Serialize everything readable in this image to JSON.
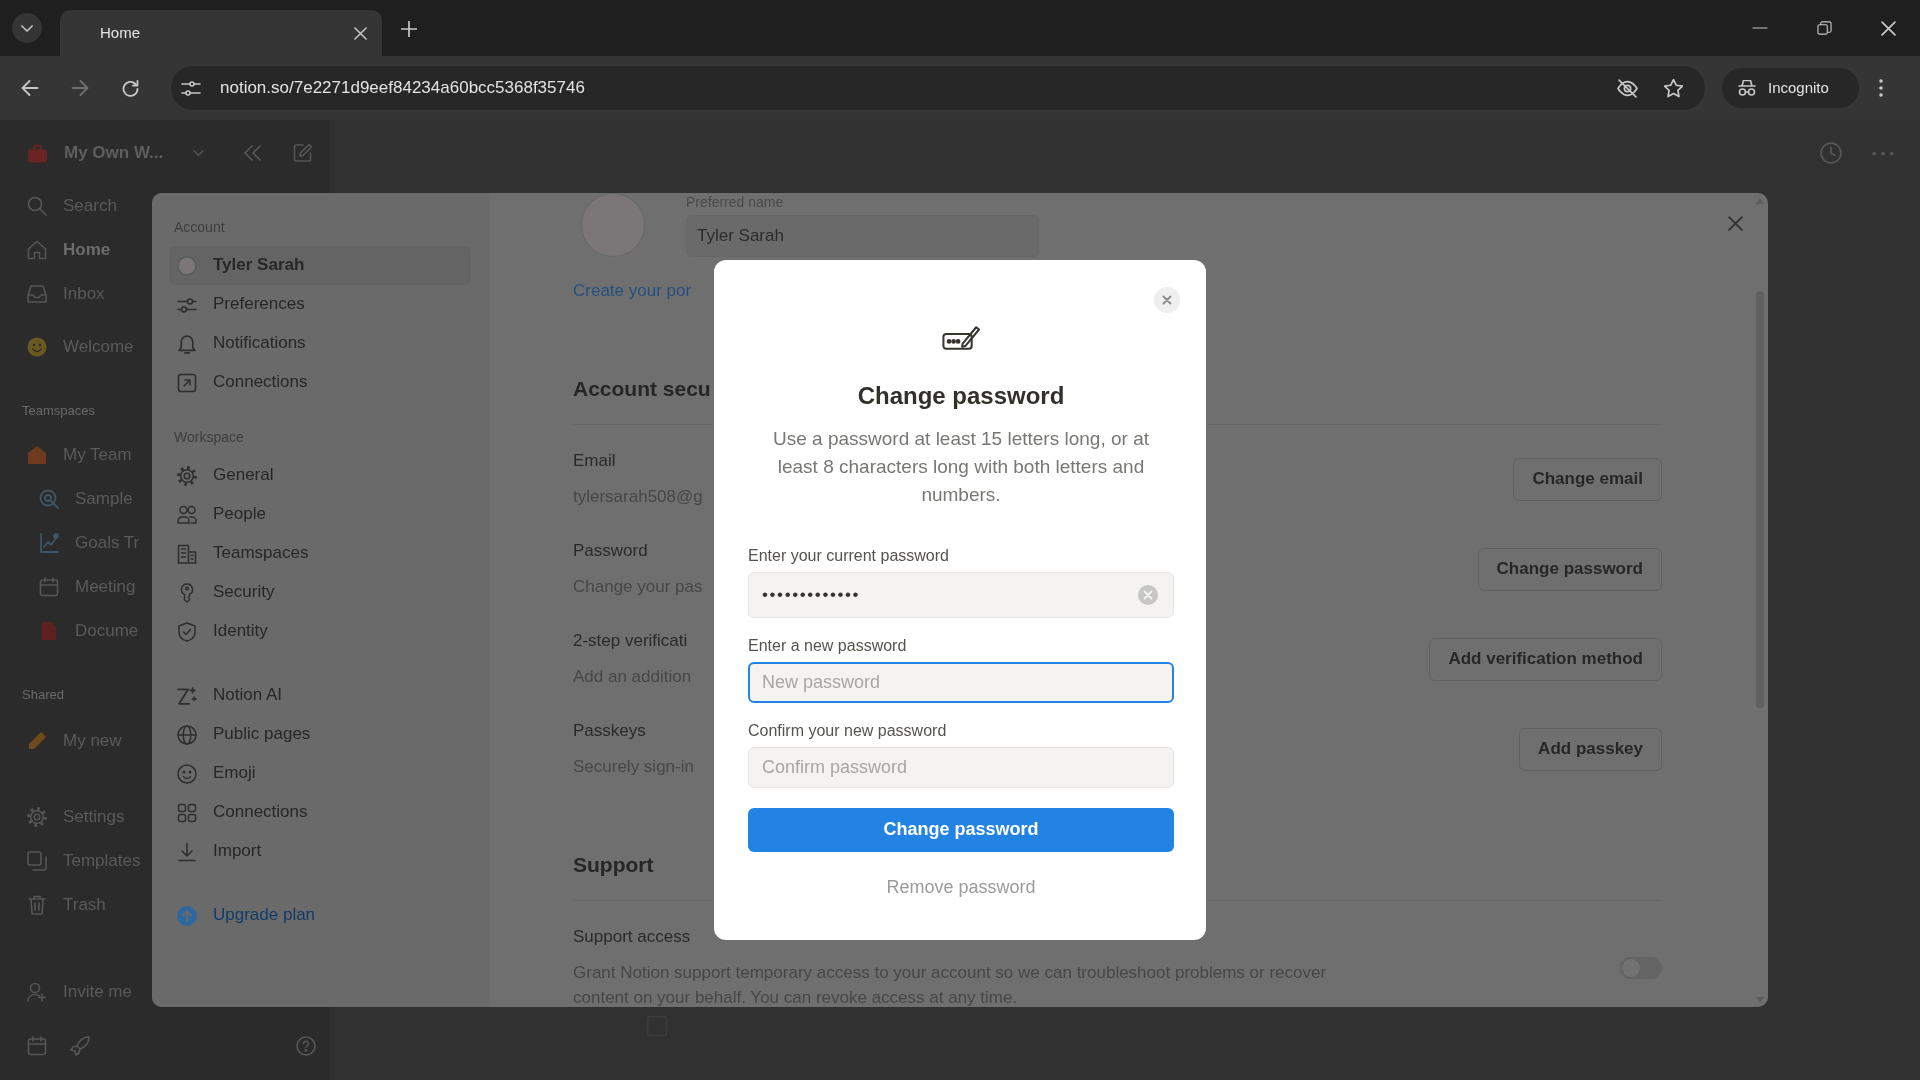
{
  "browser": {
    "tabs": [
      {
        "title": "Home",
        "selected": true
      }
    ],
    "forward_disabled": true,
    "url": "notion.so/7e2271d9eef84234a60bcc5368f35746",
    "profile": "Incognito"
  },
  "sidebar": {
    "workspace": "My Own W...",
    "items": [
      {
        "label": "Search",
        "selected": false
      },
      {
        "label": "Home",
        "selected": true
      },
      {
        "label": "Inbox",
        "selected": false
      },
      {
        "label": "Welcome",
        "selected": false
      }
    ],
    "sections": [
      {
        "title": "Teamspaces",
        "items": [
          {
            "label": "My Team",
            "selected": false,
            "children": [
              {
                "label": "Sample",
                "selected": false
              },
              {
                "label": "Goals Tr",
                "selected": false
              },
              {
                "label": "Meeting",
                "selected": false
              },
              {
                "label": "Docume",
                "selected": false
              }
            ]
          }
        ]
      },
      {
        "title": "Shared",
        "items": [
          {
            "label": "My new",
            "selected": false
          }
        ]
      }
    ],
    "footer_items": [
      {
        "label": "Settings"
      },
      {
        "label": "Templates"
      },
      {
        "label": "Trash"
      }
    ],
    "invite": "Invite me"
  },
  "settings": {
    "nav": [
      {
        "title": "Account",
        "items": [
          {
            "label": "Tyler Sarah",
            "selected": true
          },
          {
            "label": "Preferences",
            "selected": false
          },
          {
            "label": "Notifications",
            "selected": false
          },
          {
            "label": "Connections",
            "selected": false
          }
        ]
      },
      {
        "title": "Workspace",
        "items": [
          {
            "label": "General",
            "selected": false
          },
          {
            "label": "People",
            "selected": false
          },
          {
            "label": "Teamspaces",
            "selected": false
          },
          {
            "label": "Security",
            "selected": false
          },
          {
            "label": "Identity",
            "selected": false
          }
        ]
      },
      {
        "items": [
          {
            "label": "Notion AI",
            "selected": false
          },
          {
            "label": "Public pages",
            "selected": false
          },
          {
            "label": "Emoji",
            "selected": false
          },
          {
            "label": "Connections",
            "selected": false
          },
          {
            "label": "Import",
            "selected": false
          }
        ]
      }
    ],
    "upgrade": "Upgrade plan",
    "profile": {
      "name_label": "Preferred name",
      "name_value": "Tyler Sarah",
      "link": "Create your por"
    },
    "sections": [
      {
        "title": "Account secu",
        "rows": [
          {
            "kind": "button",
            "label": "Email",
            "detail": "tylersarah508@g",
            "action": "Change email"
          },
          {
            "kind": "button",
            "label": "Password",
            "detail": "Change your pas",
            "action": "Change password"
          },
          {
            "kind": "button",
            "label": "2-step verificati",
            "detail": "Add an addition",
            "action": "Add verification method"
          },
          {
            "kind": "button",
            "label": "Passkeys",
            "detail": "Securely sign-in",
            "action": "Add passkey"
          }
        ]
      },
      {
        "title": "Support",
        "rows": [
          {
            "kind": "toggle",
            "label": "Support access",
            "detail": "Grant Notion support temporary access to your account so we can troubleshoot problems or recover content on your behalf. You can revoke access at any time.",
            "on": false
          }
        ]
      }
    ]
  },
  "password_dialog": {
    "title": "Change password",
    "description": "Use a password at least 15 letters long, or at least 8 characters long with both letters and numbers.",
    "fields": [
      {
        "label": "Enter your current password",
        "value": "•••••••••••••",
        "clearable": true,
        "focused": false
      },
      {
        "label": "Enter a new password",
        "placeholder": "New password",
        "clearable": false,
        "focused": true
      },
      {
        "label": "Confirm your new password",
        "placeholder": "Confirm password",
        "clearable": false,
        "focused": false
      }
    ],
    "submit": "Change password",
    "secondary": "Remove password"
  }
}
